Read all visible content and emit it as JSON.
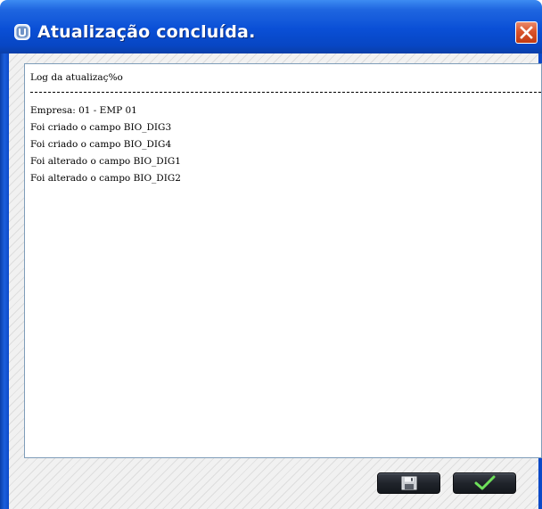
{
  "window": {
    "title": "Atualização concluída.",
    "title_icon": "update-app-icon",
    "close_icon": "close-icon"
  },
  "log": {
    "lines": [
      "Log da atualizaç%o",
      "Empresa: 01 - EMP 01",
      "Foi criado o campo BIO_DIG3",
      "Foi criado o campo BIO_DIG4",
      "Foi alterado o campo BIO_DIG1",
      "Foi alterado o campo BIO_DIG2"
    ]
  },
  "buttons": {
    "save_icon": "save-disk-icon",
    "confirm_icon": "checkmark-icon"
  },
  "colors": {
    "titlebar": "#0a4fd6",
    "close_button": "#d9532b",
    "checkmark": "#6ee05a",
    "button_dark": "#20242b"
  }
}
